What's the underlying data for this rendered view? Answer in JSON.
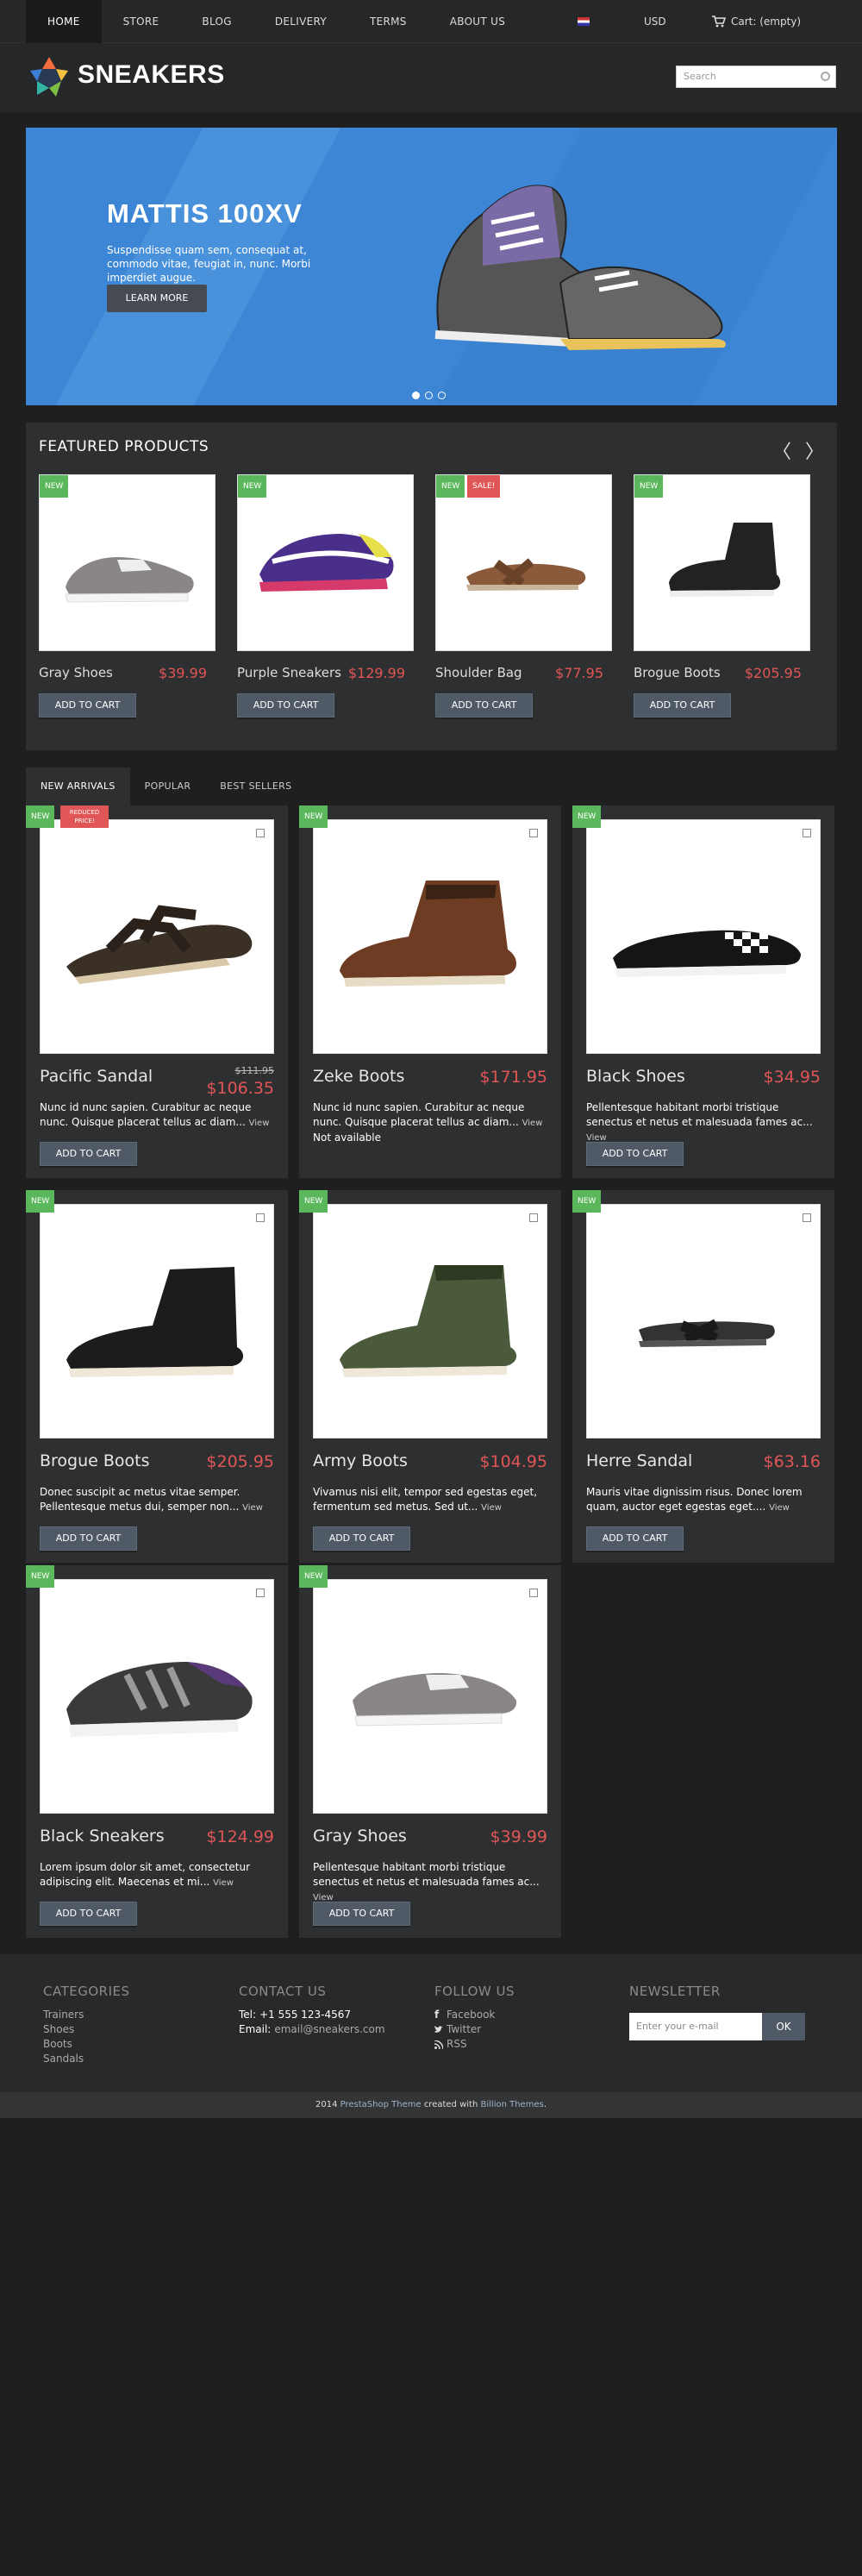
{
  "nav": {
    "items": [
      "HOME",
      "STORE",
      "BLOG",
      "DELIVERY",
      "TERMS",
      "ABOUT US"
    ],
    "currency": "USD",
    "cart": "Cart: (empty)"
  },
  "header": {
    "brand": "SNEAKERS",
    "search_placeholder": "Search"
  },
  "slider": {
    "title": "MATTIS 100XV",
    "text": "Suspendisse quam sem, consequat at, commodo vitae, feugiat in, nunc. Morbi imperdiet augue.",
    "button": "LEARN MORE",
    "slide_count": 3,
    "active_slide": 1
  },
  "featured": {
    "title": "FEATURED PRODUCTS",
    "prev": "〈",
    "next": "〉",
    "products": [
      {
        "name": "Gray Shoes",
        "price": "$39.99",
        "badges": [
          "NEW"
        ]
      },
      {
        "name": "Purple Sneakers",
        "price": "$129.99",
        "badges": [
          "NEW"
        ]
      },
      {
        "name": "Shoulder Bag",
        "price": "$77.95",
        "badges": [
          "NEW",
          "SALE!"
        ]
      },
      {
        "name": "Brogue Boots",
        "price": "$205.95",
        "badges": [
          "NEW"
        ]
      }
    ],
    "cart_label": "ADD TO CART"
  },
  "tabs": [
    "NEW ARRIVALS",
    "POPULAR",
    "BEST SELLERS"
  ],
  "products": [
    {
      "name": "Pacific Sandal",
      "old_price": "$111.95",
      "price": "$106.35",
      "desc": "Nunc id nunc sapien. Curabitur ac neque nunc. Quisque placerat tellus ac diam...",
      "badge": "NEW",
      "badge2": "REDUCED PRICE!"
    },
    {
      "name": "Zeke Boots",
      "price": "$171.95",
      "desc": "Nunc id nunc sapien. Curabitur ac neque nunc. Quisque placerat tellus ac diam...",
      "extra": "Not available",
      "badge": "NEW"
    },
    {
      "name": "Black Shoes",
      "price": "$34.95",
      "desc": "Pellentesque habitant morbi tristique senectus et netus et malesuada fames ac...",
      "badge": "NEW"
    },
    {
      "name": "Brogue Boots",
      "price": "$205.95",
      "desc": "Donec suscipit ac metus vitae semper. Pellentesque metus dui, semper non...",
      "badge": "NEW"
    },
    {
      "name": "Army Boots",
      "price": "$104.95",
      "desc": "Vivamus nisi elit, tempor sed egestas eget, fermentum sed metus. Sed ut...",
      "badge": "NEW"
    },
    {
      "name": "Herre Sandal",
      "price": "$63.16",
      "desc": "Mauris vitae dignissim risus. Donec lorem quam, auctor eget egestas eget....",
      "badge": "NEW"
    },
    {
      "name": "Black Sneakers",
      "price": "$124.99",
      "desc": "Lorem ipsum dolor sit amet, consectetur adipiscing elit. Maecenas et mi...",
      "badge": "NEW"
    },
    {
      "name": "Gray Shoes",
      "price": "$39.99",
      "desc": "Pellentesque habitant morbi tristique senectus et netus et malesuada fames ac...",
      "badge": "NEW"
    }
  ],
  "view_label": "View",
  "footer": {
    "categories_title": "CATEGORIES",
    "categories": [
      "Trainers",
      "Shoes",
      "Boots",
      "Sandals"
    ],
    "contact_title": "CONTACT US",
    "tel_label": "Tel:",
    "tel": "+1 555 123-4567",
    "email_label": "Email:",
    "email": "email@sneakers.com",
    "follow_title": "FOLLOW US",
    "follow": [
      "Facebook",
      "Twitter",
      "RSS"
    ],
    "newsletter_title": "NEWSLETTER",
    "newsletter_placeholder": "Enter your e-mail",
    "newsletter_button": "OK"
  },
  "copyright": {
    "year": "2014",
    "theme": "PrestaShop Theme",
    "created": "created with",
    "author": "Billion Themes"
  }
}
